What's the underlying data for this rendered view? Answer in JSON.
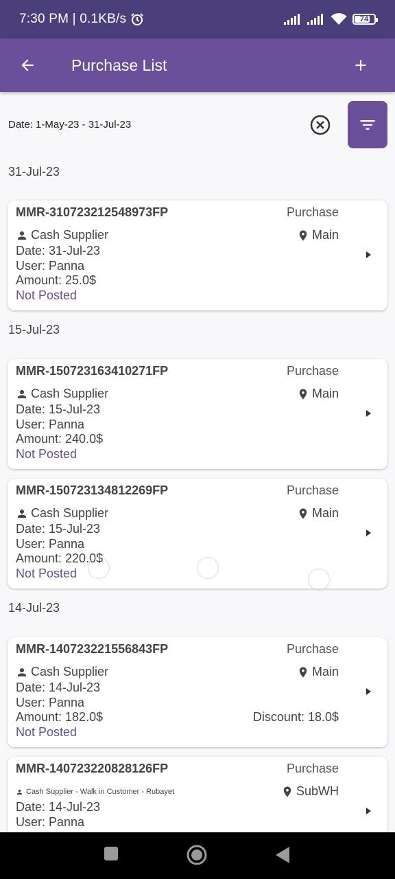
{
  "status_bar": {
    "time": "7:30 PM",
    "separator": "|",
    "speed": "0.1KB/s",
    "battery": "74"
  },
  "app_bar": {
    "title": "Purchase List"
  },
  "filter": {
    "date_range": "Date: 1-May-23 - 31-Jul-23"
  },
  "groups": [
    {
      "date": "31-Jul-23"
    },
    {
      "date": "15-Jul-23"
    },
    {
      "date": "14-Jul-23"
    }
  ],
  "cards": [
    {
      "ref": "MMR-310723212548973FP",
      "type": "Purchase",
      "supplier": "Cash Supplier",
      "location": "Main",
      "date": "Date: 31-Jul-23",
      "user": "User: Panna",
      "amount": "Amount: 25.0$",
      "status": "Not Posted"
    },
    {
      "ref": "MMR-150723163410271FP",
      "type": "Purchase",
      "supplier": "Cash Supplier",
      "location": "Main",
      "date": "Date: 15-Jul-23",
      "user": "User: Panna",
      "amount": "Amount: 240.0$",
      "status": "Not Posted"
    },
    {
      "ref": "MMR-150723134812269FP",
      "type": "Purchase",
      "supplier": "Cash Supplier",
      "location": "Main",
      "date": "Date: 15-Jul-23",
      "user": "User: Panna",
      "amount": "Amount: 220.0$",
      "status": "Not Posted"
    },
    {
      "ref": "MMR-140723221556843FP",
      "type": "Purchase",
      "supplier": "Cash Supplier",
      "location": "Main",
      "date": "Date: 14-Jul-23",
      "user": "User: Panna",
      "amount": "Amount: 182.0$",
      "discount": "Discount: 18.0$",
      "status": "Not Posted"
    },
    {
      "ref": "MMR-140723220828126FP",
      "type": "Purchase",
      "supplier": "Cash Supplier - Walk in Customer - Rubayet",
      "location": "SubWH",
      "date": "Date: 14-Jul-23",
      "user": "User: Panna"
    }
  ],
  "colors": {
    "accent": "#6a4f9a",
    "status_bar": "#4a3f7b",
    "background": "#f8f8fa"
  }
}
